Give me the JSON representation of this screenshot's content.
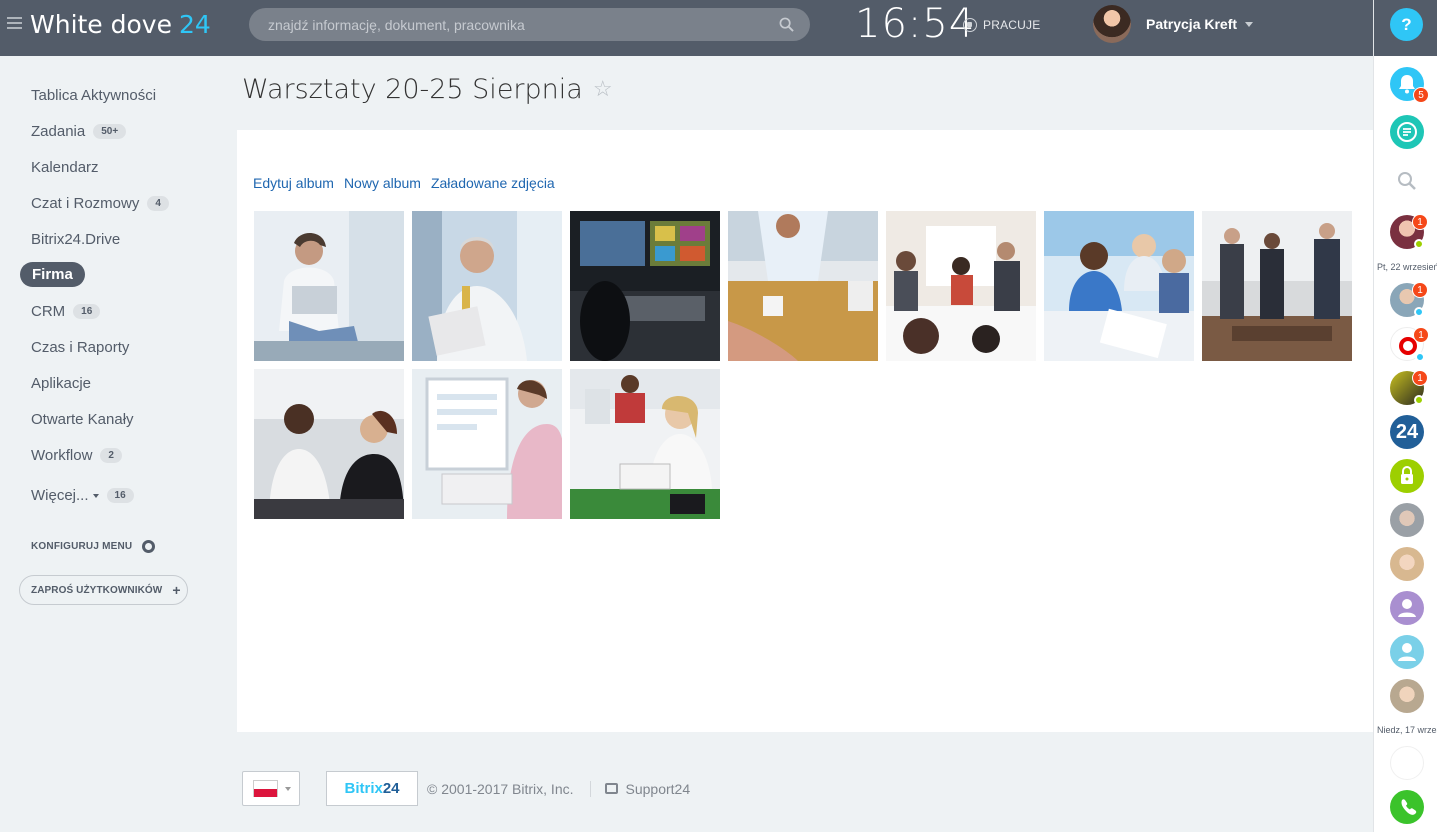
{
  "header": {
    "logo_text": "White dove",
    "logo_number": "24",
    "search_placeholder": "znajdź informację, dokument, pracownika",
    "clock": "16:54",
    "status": "PRACUJE",
    "user_name": "Patrycja Kreft",
    "help_label": "?"
  },
  "menu": {
    "items": [
      {
        "label": "Tablica Aktywności"
      },
      {
        "label": "Zadania",
        "count": "50+"
      },
      {
        "label": "Kalendarz"
      },
      {
        "label": "Czat i Rozmowy",
        "count": "4"
      },
      {
        "label": "Bitrix24.Drive"
      },
      {
        "label": "Firma"
      },
      {
        "label": "CRM",
        "count": "16"
      },
      {
        "label": "Czas i Raporty"
      },
      {
        "label": "Aplikacje"
      },
      {
        "label": "Otwarte Kanały"
      },
      {
        "label": "Workflow",
        "count": "2"
      },
      {
        "label": "Więcej...",
        "count": "16"
      }
    ],
    "configure": "KONFIGURUJ MENU",
    "invite": "ZAPROŚ UŻYTKOWNIKÓW"
  },
  "page": {
    "title": "Warsztaty 20-25 Sierpnia",
    "star": "☆",
    "actions": [
      "Edytuj album",
      "Nowy album",
      "Załadowane zdjęcia"
    ]
  },
  "rightbar": {
    "notif_count": "5",
    "chat_badges": [
      "1",
      "1",
      "1",
      "1"
    ],
    "date_labels": [
      "Pt, 22 wrzesień",
      "Niedz, 17 wrzesień"
    ],
    "b24_label": "24"
  },
  "footer": {
    "brand_a": "Bitrix",
    "brand_b": "24",
    "copyright": "© 2001-2017 Bitrix, Inc.",
    "support": "Support24"
  },
  "colors": {
    "header_bg": "#535c69",
    "accent": "#2fc6f6",
    "link": "#2067b0",
    "badge": "#f54819"
  }
}
